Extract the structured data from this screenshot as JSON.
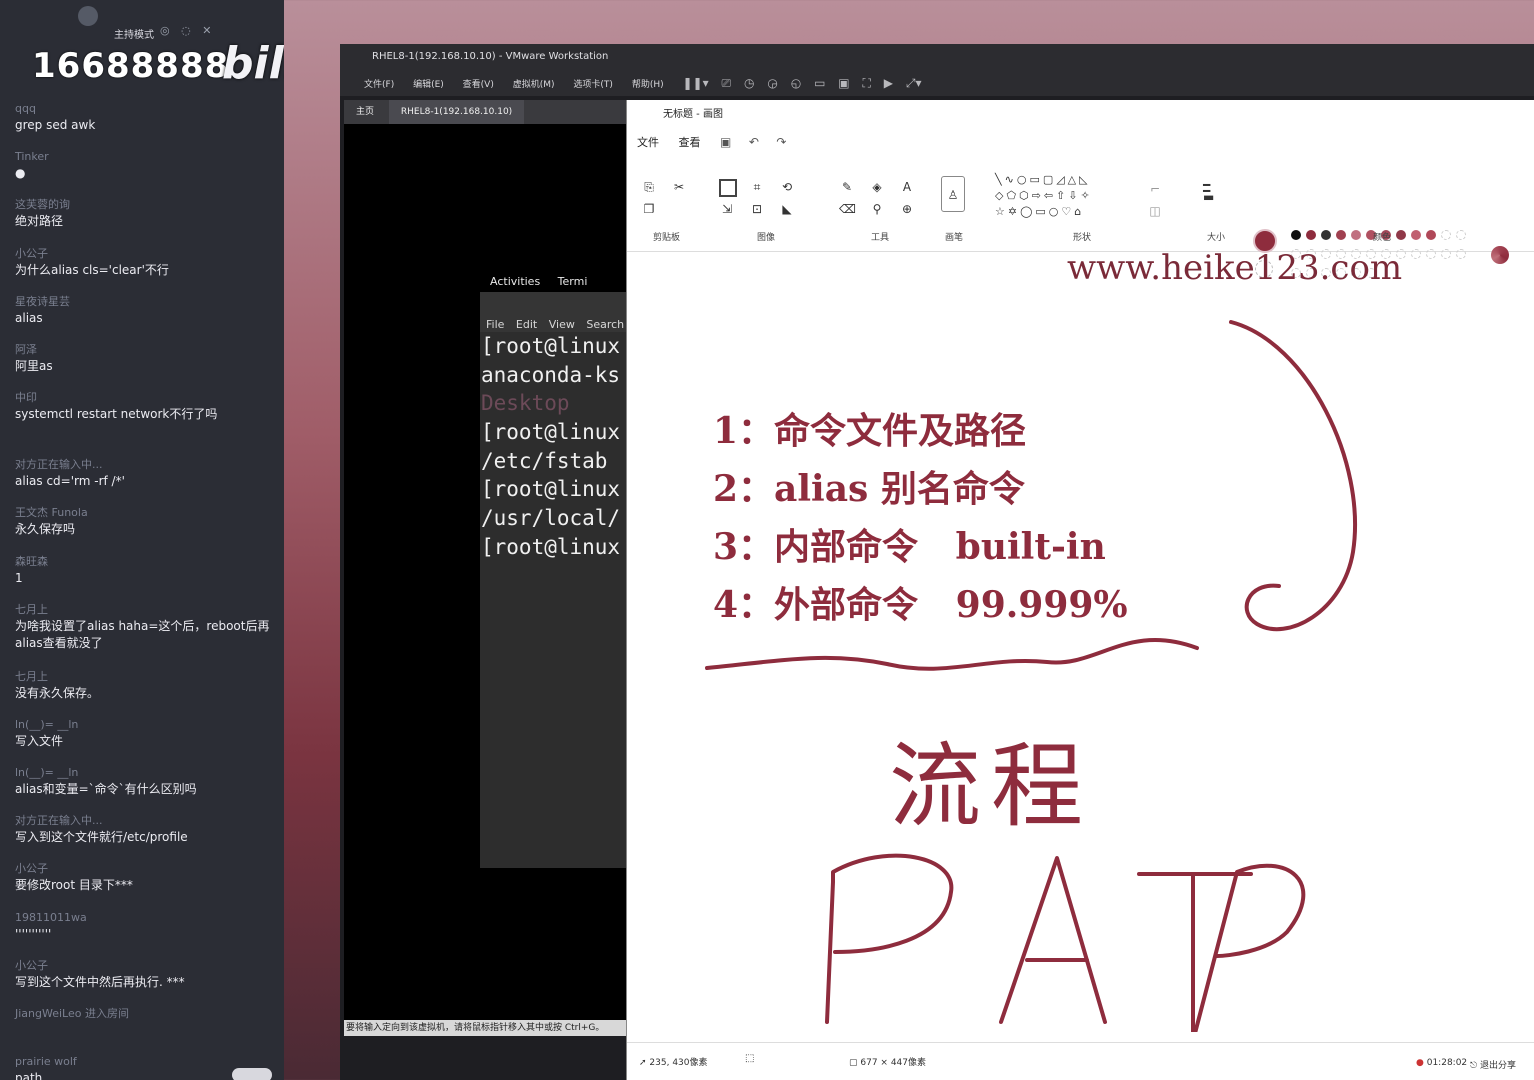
{
  "chat": {
    "host_mode": "主持模式",
    "room_number": "16688888",
    "brand": "bili",
    "messages": [
      {
        "user": "qqq",
        "text": "grep sed awk"
      },
      {
        "user": "Tinker",
        "text": "●"
      },
      {
        "user": "这芙蓉的询",
        "text": "绝对路径"
      },
      {
        "user": "小公子",
        "text": "为什么alias cls='clear'不行"
      },
      {
        "user": "星夜诗星芸",
        "text": "alias"
      },
      {
        "user": "阿泽",
        "text": "阿里as"
      },
      {
        "user": "中印",
        "text": "systemctl restart network不行了吗"
      },
      {
        "user": "对方正在输入中...",
        "text": "alias cd='rm -rf /*'"
      },
      {
        "user": "王文杰 Funola",
        "text": "永久保存吗"
      },
      {
        "user": "森旺森",
        "text": "1"
      },
      {
        "user": "七月上",
        "text": "为啥我设置了alias haha=这个后，reboot后再alias查看就没了"
      },
      {
        "user": "七月上",
        "text": "没有永久保存。"
      },
      {
        "user": "ln(__)= __ln",
        "text": "写入文件"
      },
      {
        "user": "ln(__)= __ln",
        "text": "alias和变量=`命令`有什么区别吗"
      },
      {
        "user": "对方正在输入中...",
        "text": "写入到这个文件就行/etc/profile"
      },
      {
        "user": "小公子",
        "text": "要修改root 目录下***"
      },
      {
        "user": "19811011wa",
        "text": "'''''''''''"
      },
      {
        "user": "小公子",
        "text": "写到这个文件中然后再执行. ***"
      },
      {
        "user": "JiangWeiLeo 进入房间",
        "text": ""
      },
      {
        "user": "prairie wolf",
        "text": "path"
      }
    ]
  },
  "vmware": {
    "title": "RHEL8-1(192.168.10.10) - VMware Workstation",
    "menu": [
      "文件(F)",
      "编辑(E)",
      "查看(V)",
      "虚拟机(M)",
      "选项卡(T)",
      "帮助(H)"
    ],
    "tabs": [
      "主页",
      "RHEL8-1(192.168.10.10)"
    ],
    "gnome_activities": "Activities",
    "gnome_terminal": "Termi",
    "status": "要将输入定向到该虚拟机，请将鼠标指针移入其中或按 Ctrl+G。"
  },
  "terminal": {
    "menu": [
      "File",
      "Edit",
      "View",
      "Search"
    ],
    "lines": [
      {
        "text": "[root@linux",
        "kind": "prompt"
      },
      {
        "text": "anaconda-ks",
        "kind": "out"
      },
      {
        "text": "Desktop",
        "kind": "dir"
      },
      {
        "text": "[root@linux",
        "kind": "prompt"
      },
      {
        "text": "/etc/fstab",
        "kind": "out"
      },
      {
        "text": "[root@linux",
        "kind": "prompt"
      },
      {
        "text": "/usr/local/",
        "kind": "out"
      },
      {
        "text": "[root@linux",
        "kind": "prompt"
      }
    ]
  },
  "paint": {
    "title": "无标题 - 画图",
    "menu": [
      "文件",
      "查看"
    ],
    "groups": [
      "剪贴板",
      "图像",
      "工具",
      "画笔",
      "形状",
      "大小",
      "颜色"
    ],
    "watermark": "www.heike123.com",
    "notes": [
      "1：命令文件及路径",
      "2：alias 别名命令",
      "3：内部命令   built-in",
      "4：外部命令   99.999%"
    ],
    "handwriting_chars": "流程",
    "handwriting_word": "PATP",
    "primary_color": "#8e2c3d",
    "cursor_position": "235, 430像素",
    "canvas_size": "677 × 447像素"
  },
  "taskbar": {
    "clock": "01:28:02",
    "exit_share": "退出分享"
  }
}
